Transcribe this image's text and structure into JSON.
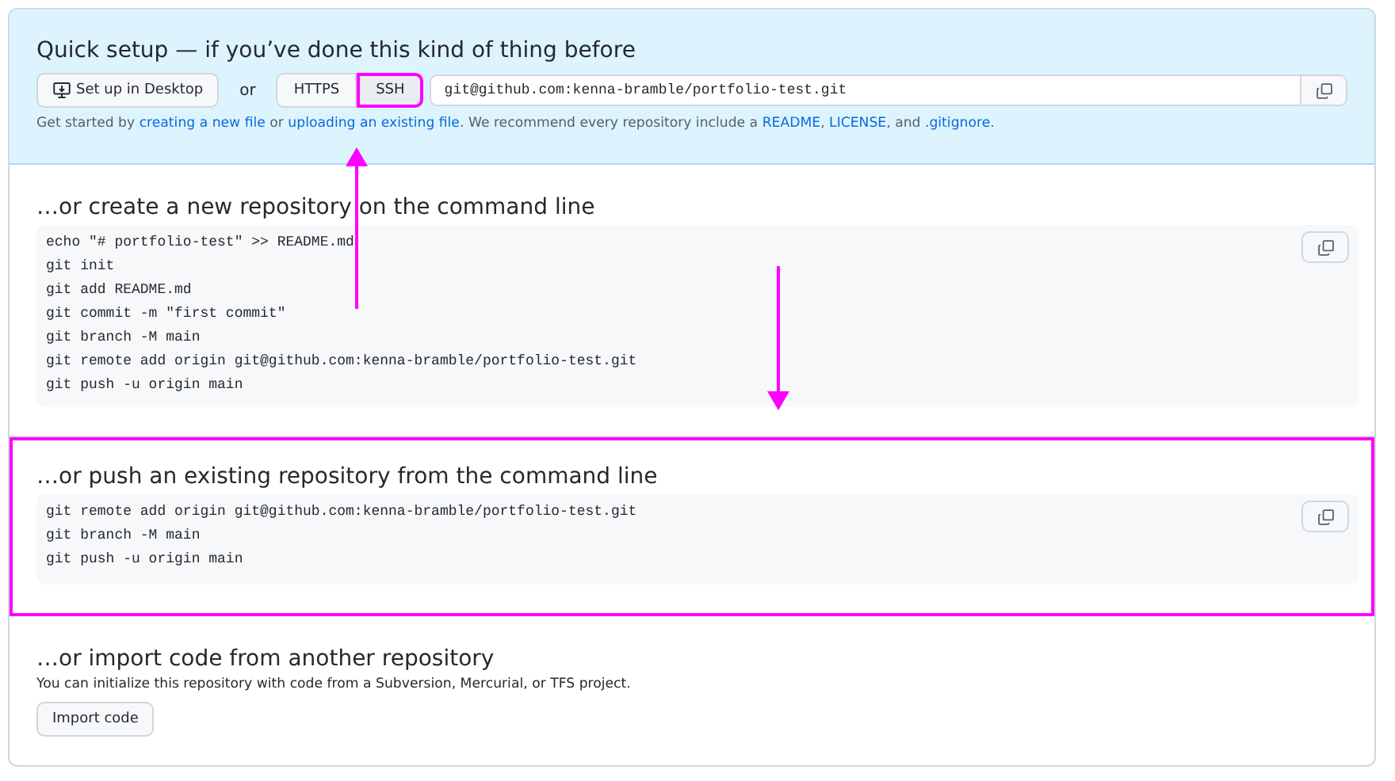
{
  "quick_setup": {
    "title": "Quick setup — if you’ve done this kind of thing before",
    "desktop_button": "Set up in Desktop",
    "or": "or",
    "protocols": [
      {
        "label": "HTTPS",
        "selected": false,
        "highlighted": false
      },
      {
        "label": "SSH",
        "selected": true,
        "highlighted": true
      }
    ],
    "clone_url": "git@github.com:kenna-bramble/portfolio-test.git",
    "hint": [
      {
        "kind": "text",
        "text": "Get started by "
      },
      {
        "kind": "link",
        "text": "creating a new file"
      },
      {
        "kind": "text",
        "text": " or "
      },
      {
        "kind": "link",
        "text": "uploading an existing file"
      },
      {
        "kind": "text",
        "text": ". We recommend every repository include a "
      },
      {
        "kind": "link",
        "text": "README"
      },
      {
        "kind": "text",
        "text": ", "
      },
      {
        "kind": "link",
        "text": "LICENSE"
      },
      {
        "kind": "text",
        "text": ", and "
      },
      {
        "kind": "link",
        "text": ".gitignore"
      },
      {
        "kind": "text",
        "text": "."
      }
    ]
  },
  "sections": [
    {
      "kind": "code",
      "title": "…or create a new repository on the command line",
      "highlighted": false,
      "lines": [
        "echo \"# portfolio-test\" >> README.md",
        "git init",
        "git add README.md",
        "git commit -m \"first commit\"",
        "git branch -M main",
        "git remote add origin git@github.com:kenna-bramble/portfolio-test.git",
        "git push -u origin main"
      ]
    },
    {
      "kind": "code",
      "title": "…or push an existing repository from the command line",
      "highlighted": true,
      "lines": [
        "git remote add origin git@github.com:kenna-bramble/portfolio-test.git",
        "git branch -M main",
        "git push -u origin main"
      ]
    },
    {
      "kind": "import",
      "title": "…or import code from another repository",
      "highlighted": false,
      "text": "You can initialize this repository with code from a Subversion, Mercurial, or TFS project.",
      "button": "Import code"
    }
  ]
}
